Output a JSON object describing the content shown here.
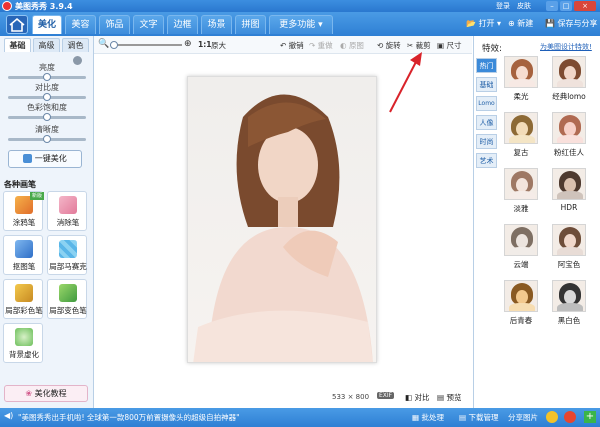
{
  "app": {
    "title": "美图秀秀 3.9.4"
  },
  "window": {
    "login": "登录",
    "skin": "皮肤",
    "menu": "▾",
    "min": "–",
    "max": "□",
    "close": "×"
  },
  "nav": {
    "tabs": [
      "美化",
      "美容",
      "饰品",
      "文字",
      "边框",
      "场景",
      "拼图",
      "更多功能 ▾"
    ],
    "active": "美化",
    "open": "打开",
    "new": "新建",
    "save": "保存与分享"
  },
  "left": {
    "subtabs": [
      "基础",
      "高级",
      "调色"
    ],
    "sliders": [
      {
        "label": "亮度",
        "value": 0.5
      },
      {
        "label": "对比度",
        "value": 0.5
      },
      {
        "label": "色彩饱和度",
        "value": 0.5
      },
      {
        "label": "清晰度",
        "value": 0.5
      }
    ],
    "one_click": "一键美化",
    "brush_header": "各种画笔",
    "tools": [
      {
        "label": "涂鸦笔",
        "icon": "pencil-icon",
        "badge": "新版"
      },
      {
        "label": "消除笔",
        "icon": "eraser-icon"
      },
      {
        "label": "抠图笔",
        "icon": "cutout-pen-icon"
      },
      {
        "label": "局部马赛克",
        "icon": "mosaic-icon"
      },
      {
        "label": "局部彩色笔",
        "icon": "color-brush-icon"
      },
      {
        "label": "局部变色笔",
        "icon": "recolor-brush-icon"
      },
      {
        "label": "背景虚化",
        "icon": "blur-icon"
      }
    ],
    "tutorial": "美化教程"
  },
  "toolbar": {
    "zoom_label": "1:1",
    "original": "原大",
    "undo": "撤销",
    "redo": "重做",
    "orig_pic": "原图",
    "rotate": "旋转",
    "crop": "裁剪",
    "size": "尺寸"
  },
  "status": {
    "dims": "533 × 800",
    "exif": "EXIF",
    "compare": "对比",
    "preview": "预览"
  },
  "right": {
    "header": "特效:",
    "link": "为美图设计特效!",
    "tabs": [
      "热门",
      "基础",
      "Lomo",
      "人像",
      "时尚",
      "艺术"
    ],
    "active_tab": "热门",
    "effects": [
      "柔光",
      "经典lomo",
      "复古",
      "粉红佳人",
      "淡雅",
      "HDR",
      "云端",
      "阿宝色",
      "后青春",
      "黑白色"
    ]
  },
  "bottom": {
    "message": "\"美图秀秀出手机啦! 全球第一款800万前置摄像头的超级自拍神器\"",
    "batch": "批处理",
    "download": "下载管理",
    "share": "分享图片"
  },
  "colors": {
    "accent": "#2e7fd4",
    "arrow": "#d9232a"
  }
}
